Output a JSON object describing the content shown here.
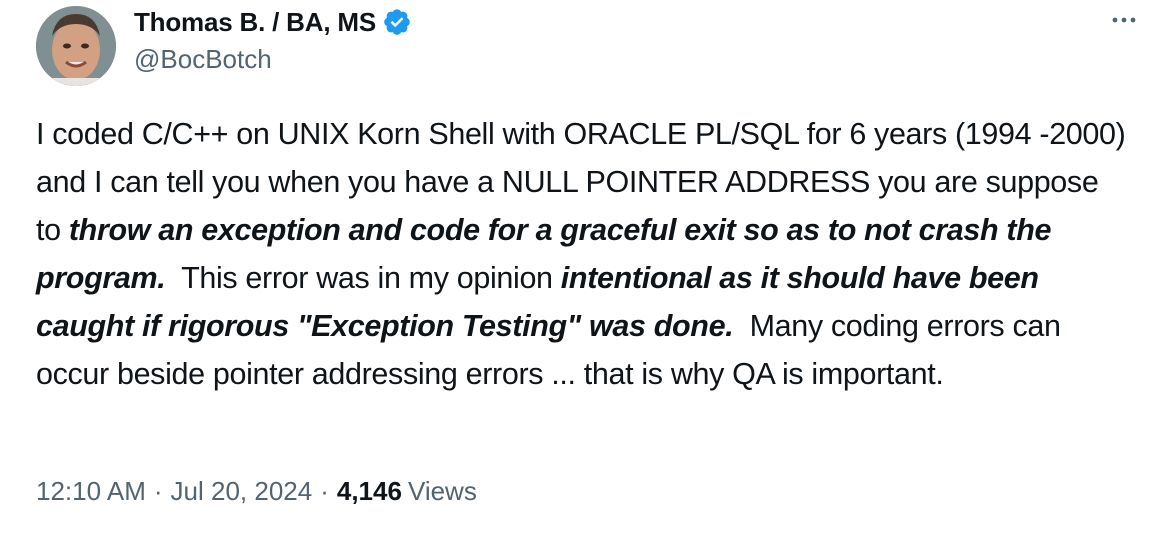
{
  "author": {
    "display_name": "Thomas B. / BA, MS",
    "handle": "@BocBotch",
    "verified_icon": "verified-badge-icon",
    "badge_color": "#1d9bf0"
  },
  "tweet": {
    "segments": [
      {
        "text": "I coded C/C++ on UNIX Korn Shell with ORACLE PL/SQL for 6 years (1994 -2000) and I can tell you when you have a NULL POINTER ADDRESS you are suppose to ",
        "emphasis": false
      },
      {
        "text": "throw an exception and code for a graceful exit so as to not crash the program.",
        "emphasis": true
      },
      {
        "text": "  This error was in my opinion ",
        "emphasis": false
      },
      {
        "text": "intentional as it should have been caught if rigorous \"Exception Testing\" was done.",
        "emphasis": true
      },
      {
        "text": "  Many coding errors can occur beside pointer addressing errors ... that is why QA is important.",
        "emphasis": false
      }
    ]
  },
  "meta": {
    "time": "12:10 AM",
    "separator": "·",
    "date": "Jul 20, 2024",
    "views_count": "4,146",
    "views_label": "Views"
  },
  "colors": {
    "text": "#0f1419",
    "secondary": "#536471",
    "accent": "#1d9bf0"
  },
  "icons": {
    "more": "more-dots-icon"
  }
}
